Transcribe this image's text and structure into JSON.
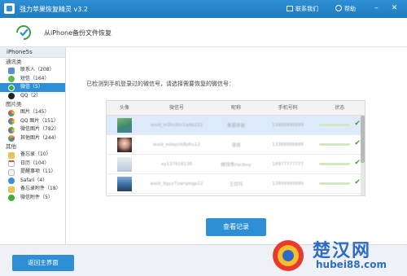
{
  "app": {
    "title": "强力苹果恢复精灵 v3.2",
    "contact_label": "联系我们",
    "help_label": "帮助"
  },
  "header": {
    "subtitle": "从iPhone备份文件恢复"
  },
  "sidebar": {
    "device": "iPhone5s",
    "sections": [
      {
        "label": "通讯类",
        "items": [
          {
            "label": "联系人（208）",
            "color": "#5a8fd6"
          },
          {
            "label": "短信（164）",
            "color": "#62b94a"
          },
          {
            "label": "微信（5）",
            "color": "#3cb034",
            "active": true
          },
          {
            "label": "QQ（2）",
            "color": "#222222"
          }
        ]
      },
      {
        "label": "图片类",
        "items": [
          {
            "label": "图片（145）",
            "color": "#e0793a"
          },
          {
            "label": "QQ 图片（151）",
            "color": "#d84c3e"
          },
          {
            "label": "微信图片（782）",
            "color": "#4aa743"
          },
          {
            "label": "其他图片（244）",
            "color": "#e9a93a"
          }
        ]
      },
      {
        "label": "其他",
        "items": [
          {
            "label": "备忘录（10）",
            "color": "#e8c35a"
          },
          {
            "label": "日历（104）",
            "color": "#ffffff"
          },
          {
            "label": "提醒事项（11）",
            "color": "#cccccc"
          },
          {
            "label": "Safari（4）",
            "color": "#3b8fe0"
          },
          {
            "label": "备忘录附件（18）",
            "color": "#e8c35a"
          },
          {
            "label": "微信附件（5）",
            "color": "#3cb034"
          }
        ]
      }
    ]
  },
  "main": {
    "prompt": "已检测到手机登录过的微信号，请选择需要恢复的微信号：",
    "table": {
      "headers": [
        "头像",
        "微信号",
        "昵称",
        "手机号码",
        "状态"
      ],
      "rows": [
        {
          "wechat_id": "wxid_m3hs9m1q4b222",
          "nickname": "蒂慕移彼",
          "phone": "13999999999",
          "avatar": "scenery",
          "selected": true
        },
        {
          "wechat_id": "wxid_edwpvk8jdtu12",
          "nickname": "谊瑶",
          "phone": "13388888888",
          "avatar": "person",
          "selected": false
        },
        {
          "wechat_id": "xy137916138",
          "nickname": "瞰钱悸(lai)bvy",
          "phone": "18977777777",
          "avatar": "placeholder",
          "selected": false
        },
        {
          "wechat_id": "wxid_9gyy7uwnpegp22",
          "nickname": "王目玛",
          "phone": "13999999999",
          "avatar": "city",
          "selected": false
        }
      ]
    },
    "view_button": "查看记录"
  },
  "footer": {
    "back_button": "返回主界面"
  },
  "watermark": {
    "text": "楚汉网",
    "url": "hubei88.com"
  }
}
